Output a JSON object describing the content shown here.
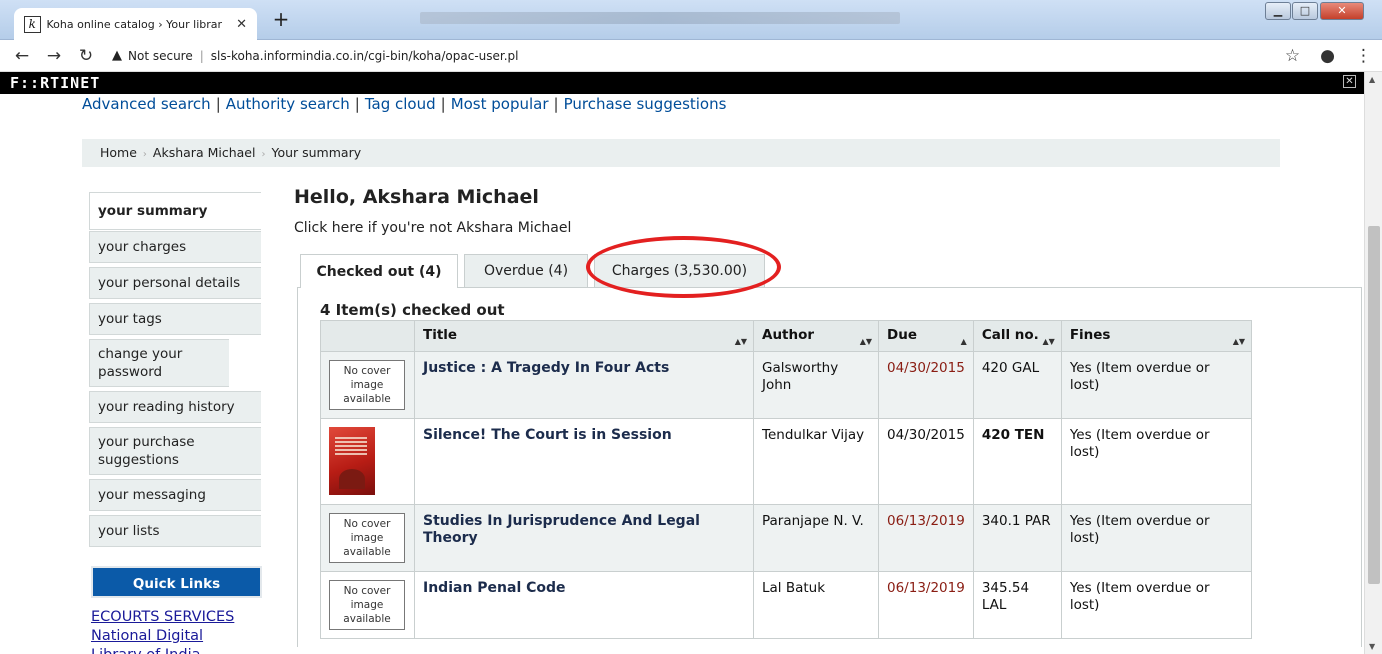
{
  "browser": {
    "tab_title": "Koha online catalog › Your librar",
    "tab_favicon": "k",
    "address_security": "Not secure",
    "address_url": "sls-koha.informindia.co.in/cgi-bin/koha/opac-user.pl"
  },
  "fortinet": {
    "logo": "F::RTINET"
  },
  "top_links": [
    "Advanced search",
    "Authority search",
    "Tag cloud",
    "Most popular",
    "Purchase suggestions"
  ],
  "breadcrumb": [
    "Home",
    "Akshara Michael",
    "Your summary"
  ],
  "sidebar": {
    "items": [
      {
        "label": "your summary",
        "active": true
      },
      {
        "label": "your charges"
      },
      {
        "label": "your personal details"
      },
      {
        "label": "your tags"
      },
      {
        "label": "change your password"
      },
      {
        "label": "your reading history"
      },
      {
        "label": "your purchase suggestions"
      },
      {
        "label": "your messaging"
      },
      {
        "label": "your lists"
      }
    ],
    "quick_links_title": "Quick Links",
    "quick_links": [
      "ECOURTS SERVICES",
      "National Digital",
      "Library of India"
    ]
  },
  "main": {
    "greeting": "Hello, Akshara Michael",
    "not_you_link": "Click here if you're not Akshara Michael",
    "tabs": [
      {
        "label": "Checked out (4)",
        "active": true
      },
      {
        "label": "Overdue (4)"
      },
      {
        "label": "Charges (3,530.00)"
      }
    ],
    "checked_out_heading": "4 Item(s) checked out",
    "table": {
      "headers": [
        "",
        "Title",
        "Author",
        "Due",
        "Call no.",
        "Fines"
      ],
      "rows": [
        {
          "cover": "No cover image available",
          "title": "Justice : A Tragedy In Four Acts",
          "author": "Galsworthy John",
          "due": "04/30/2015",
          "call_no": "420 GAL",
          "fines": "Yes (Item overdue or lost)"
        },
        {
          "cover": "image",
          "title": "Silence! The Court is in Session",
          "author": "Tendulkar Vijay",
          "due": "04/30/2015",
          "call_no": "420 TEN",
          "fines": "Yes (Item overdue or lost)"
        },
        {
          "cover": "No cover image available",
          "title": "Studies In Jurisprudence And Legal Theory",
          "author": "Paranjape N. V.",
          "due": "06/13/2019",
          "call_no": "340.1 PAR",
          "fines": "Yes (Item overdue or lost)"
        },
        {
          "cover": "No cover image available",
          "title": "Indian Penal Code",
          "author": "Lal Batuk",
          "due": "06/13/2019",
          "call_no": "345.54 LAL",
          "fines": "Yes (Item overdue or lost)"
        }
      ]
    }
  },
  "colors": {
    "accent_blue": "#0b5aa8",
    "link_blue": "#004d99",
    "highlight_red": "#e32020",
    "due_red": "#8a1d13"
  }
}
